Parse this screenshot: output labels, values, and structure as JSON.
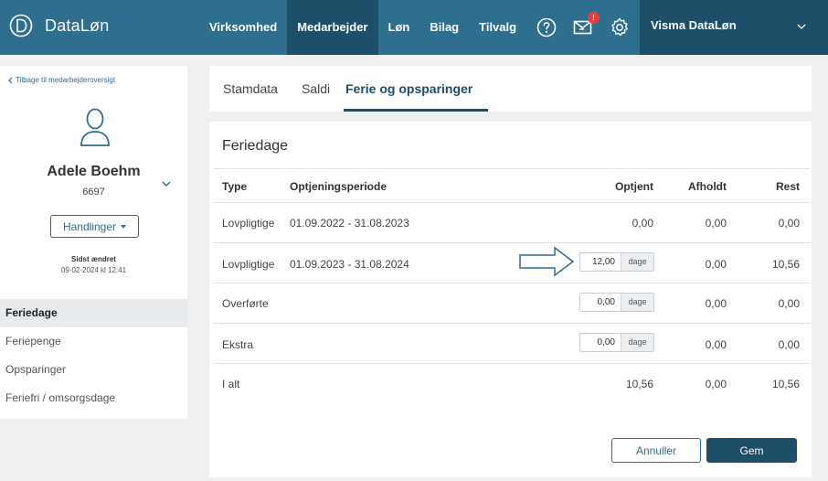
{
  "app": {
    "name": "DataLøn",
    "nav": [
      "Virksomhed",
      "Medarbejder",
      "Løn",
      "Bilag",
      "Tilvalg"
    ],
    "active_nav": "Medarbejder",
    "notification_count": "!",
    "user_menu_label": "Visma DataLøn",
    "icons": [
      "help-icon",
      "mail-icon",
      "gear-icon",
      "chevron-down-icon"
    ]
  },
  "sidebar": {
    "back_link": "Tilbage til medarbejderoversigt",
    "employee_name": "Adele Boehm",
    "employee_number": "6697",
    "actions_label": "Handlinger",
    "changed_label": "Sidst ændret",
    "changed_value": "09-02-2024 kl 12:41",
    "items": [
      "Feriedage",
      "Feriepenge",
      "Opsparinger",
      "Feriefri / omsorgsdage"
    ],
    "active_item": "Feriedage"
  },
  "tabs": [
    "Stamdata",
    "Saldi",
    "Ferie og opsparinger"
  ],
  "active_tab": "Ferie og opsparinger",
  "card": {
    "title": "Feriedage",
    "headers": [
      "Type",
      "Optjeningsperiode",
      "Optjent",
      "Afholdt",
      "Rest"
    ],
    "unit": "dage",
    "rows": [
      {
        "type": "Lovpligtige",
        "period": "01.09.2022 - 31.08.2023",
        "earned": "0,00",
        "taken": "0,00",
        "rest": "0,00",
        "editable": false
      },
      {
        "type": "Lovpligtige",
        "period": "01.09.2023 - 31.08.2024",
        "earned": "12,00",
        "taken": "0,00",
        "rest": "10,56",
        "editable": true
      },
      {
        "type": "Overførte",
        "period": "",
        "earned": "0,00",
        "taken": "0,00",
        "rest": "0,00",
        "editable": true
      },
      {
        "type": "Ekstra",
        "period": "",
        "earned": "0,00",
        "taken": "0,00",
        "rest": "0,00",
        "editable": true
      },
      {
        "type": "I alt",
        "period": "",
        "earned": "10,56",
        "taken": "0,00",
        "rest": "10,56",
        "editable": false
      }
    ],
    "cancel_label": "Annuller",
    "save_label": "Gem"
  },
  "colors": {
    "topbar": "#2e6e8e",
    "active": "#1d4f6a",
    "badge": "#e2403c",
    "background": "#eef0f2"
  }
}
